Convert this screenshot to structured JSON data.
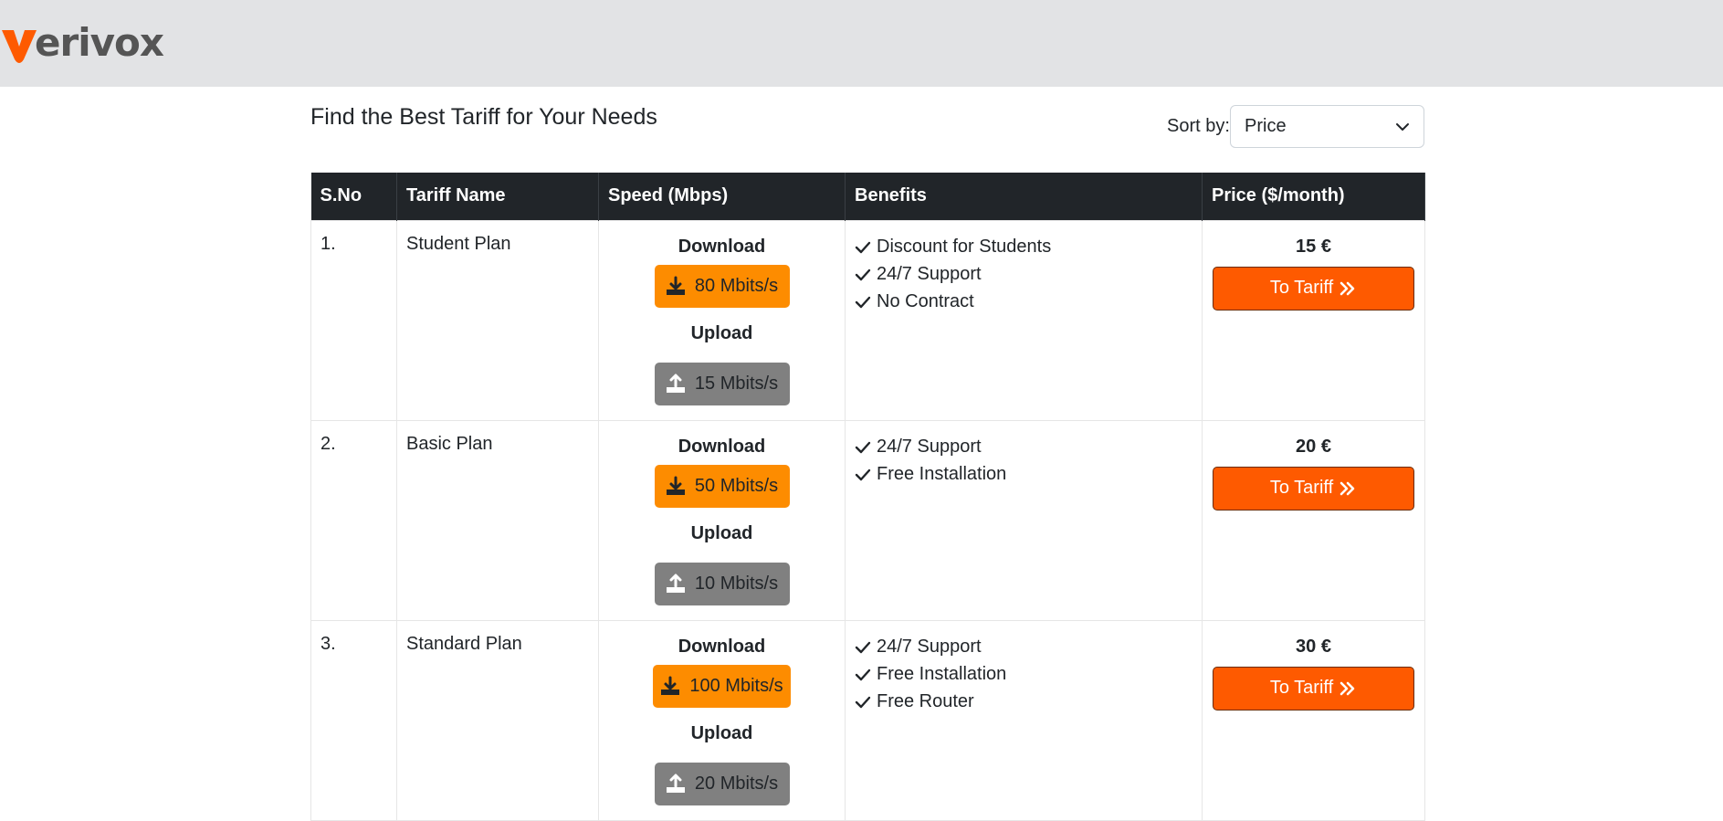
{
  "brand": {
    "logo_text": "erivox",
    "logo_mark_color": "#fe5a00"
  },
  "page": {
    "title": "Find the Best Tariff for Your Needs"
  },
  "sort": {
    "label": "Sort by:",
    "selected": "Price"
  },
  "table": {
    "headers": [
      "S.No",
      "Tariff Name",
      "Speed (Mbps)",
      "Benefits",
      "Price ($/month)"
    ],
    "rows": [
      {
        "sno": "1.",
        "name": "Student Plan",
        "download_label": "Download",
        "download": "80 Mbits/s",
        "upload_label": "Upload",
        "upload": "15 Mbits/s",
        "benefits": [
          "Discount for Students",
          "24/7 Support",
          "No Contract"
        ],
        "price": "15 €",
        "button": "To Tariff"
      },
      {
        "sno": "2.",
        "name": "Basic Plan",
        "download_label": "Download",
        "download": "50 Mbits/s",
        "upload_label": "Upload",
        "upload": "10 Mbits/s",
        "benefits": [
          "24/7 Support",
          "Free Installation"
        ],
        "price": "20 €",
        "button": "To Tariff"
      },
      {
        "sno": "3.",
        "name": "Standard Plan",
        "download_label": "Download",
        "download": "100 Mbits/s",
        "upload_label": "Upload",
        "upload": "20 Mbits/s",
        "benefits": [
          "24/7 Support",
          "Free Installation",
          "Free Router"
        ],
        "price": "30 €",
        "button": "To Tariff"
      }
    ]
  },
  "colors": {
    "header_bg": "#e2e3e5",
    "table_head_bg": "#212529",
    "download_badge": "#fd8c00",
    "upload_badge": "#808080",
    "button_bg": "#fe5a00"
  },
  "icons": {
    "logo": "verivox-v-logo-icon",
    "sort": "chevron-down-icon",
    "download": "download-icon",
    "upload": "upload-icon",
    "benefit": "check-icon",
    "button": "double-chevron-right-icon"
  }
}
